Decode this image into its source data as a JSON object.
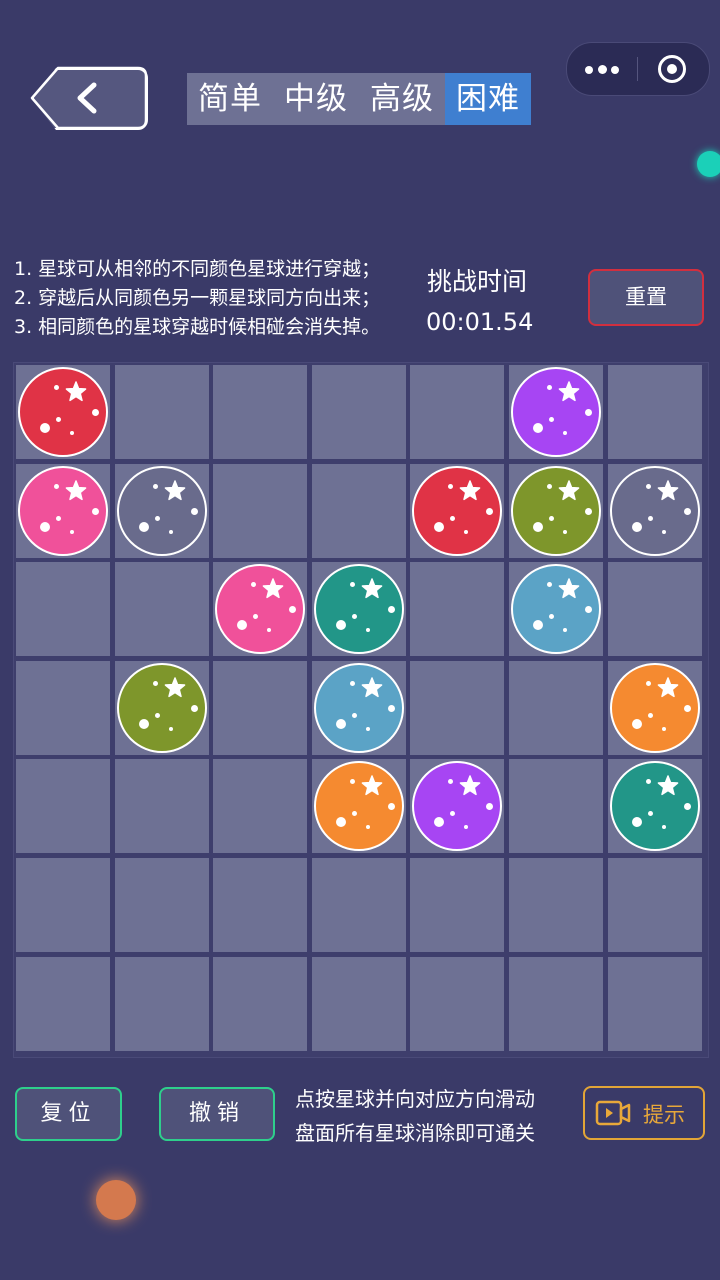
{
  "header": {
    "tabs": [
      {
        "label": "简单",
        "active": false
      },
      {
        "label": "中级",
        "active": false
      },
      {
        "label": "高级",
        "active": false
      },
      {
        "label": "困难",
        "active": true
      }
    ]
  },
  "rules": [
    "1. 星球可从相邻的不同颜色星球进行穿越；",
    "2. 穿越后从同颜色另一颗星球同方向出来；",
    "3. 相同颜色的星球穿越时候相碰会消失掉。"
  ],
  "timer": {
    "label": "挑战时间",
    "value": "00:01.54"
  },
  "reset_label": "重置",
  "board": {
    "rows": 7,
    "cols": 7,
    "balls": [
      {
        "row": 0,
        "col": 0,
        "color": "red"
      },
      {
        "row": 0,
        "col": 5,
        "color": "purple"
      },
      {
        "row": 1,
        "col": 0,
        "color": "pink"
      },
      {
        "row": 1,
        "col": 1,
        "color": "gray"
      },
      {
        "row": 1,
        "col": 4,
        "color": "red"
      },
      {
        "row": 1,
        "col": 5,
        "color": "olive"
      },
      {
        "row": 1,
        "col": 6,
        "color": "gray"
      },
      {
        "row": 2,
        "col": 2,
        "color": "pink"
      },
      {
        "row": 2,
        "col": 3,
        "color": "teal"
      },
      {
        "row": 2,
        "col": 5,
        "color": "blue"
      },
      {
        "row": 3,
        "col": 1,
        "color": "olive"
      },
      {
        "row": 3,
        "col": 3,
        "color": "blue"
      },
      {
        "row": 3,
        "col": 6,
        "color": "orange"
      },
      {
        "row": 4,
        "col": 3,
        "color": "orange"
      },
      {
        "row": 4,
        "col": 4,
        "color": "purple"
      },
      {
        "row": 4,
        "col": 6,
        "color": "teal"
      }
    ]
  },
  "colors": {
    "red": "#e03346",
    "purple": "#a745f3",
    "pink": "#f0519a",
    "gray": "#696b8c",
    "olive": "#7e962b",
    "teal": "#229688",
    "blue": "#5ba3c6",
    "orange": "#f58a30",
    "accent_tab": "#3f7fd0",
    "button_border_green": "#2ecf8c",
    "reset_border_red": "#d12f3f",
    "hint_gold": "#e2a537"
  },
  "buttons": {
    "restore_label": "复位",
    "undo_label": "撤销",
    "hint_label": "提示"
  },
  "instructions": [
    "点按星球并向对应方向滑动",
    "盘面所有星球消除即可通关"
  ],
  "icons": {
    "back": "chevron-left-icon",
    "more": "more-dots-icon",
    "close": "target-circle-icon",
    "hint": "video-play-icon"
  }
}
